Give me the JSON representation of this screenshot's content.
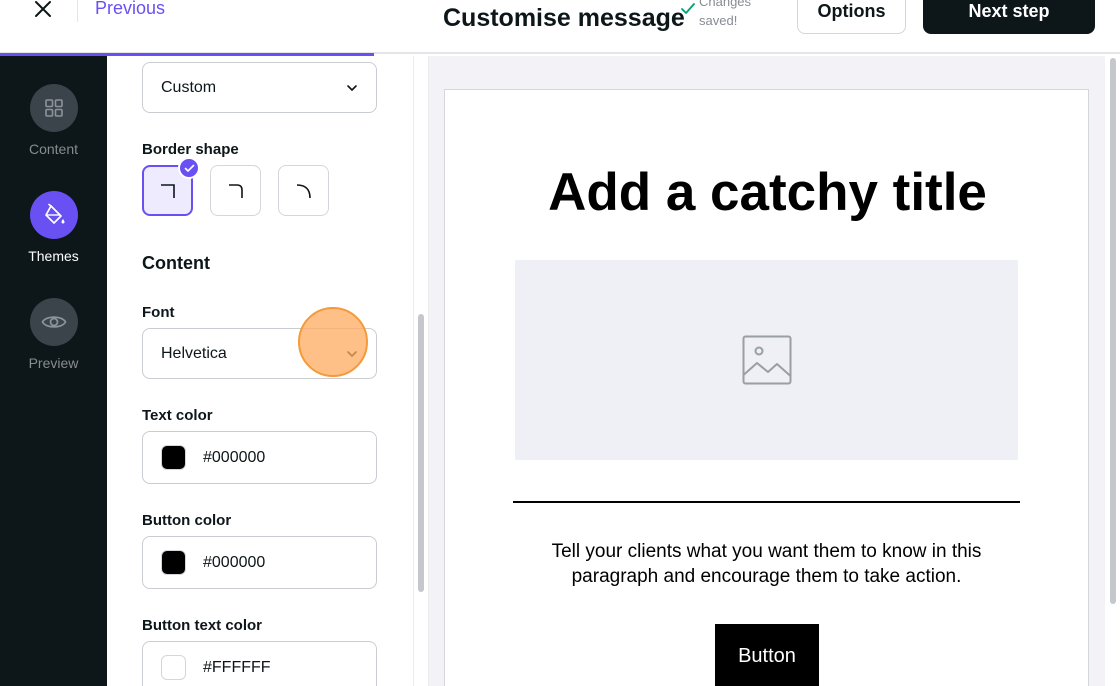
{
  "header": {
    "previous_label": "Previous",
    "title": "Customise message",
    "saved_status": "Changes saved!",
    "options_label": "Options",
    "next_label": "Next step"
  },
  "nav": {
    "items": [
      {
        "label": "Content",
        "icon": "grid-icon"
      },
      {
        "label": "Themes",
        "icon": "paint-bucket-icon",
        "active": true
      },
      {
        "label": "Preview",
        "icon": "eye-icon"
      }
    ]
  },
  "panel": {
    "style_select_value": "Custom",
    "border_shape_label": "Border shape",
    "border_shapes": [
      "square",
      "rounded",
      "round"
    ],
    "selected_border_shape": "square",
    "content_heading": "Content",
    "font_label": "Font",
    "font_value": "Helvetica",
    "text_color_label": "Text color",
    "text_color_value": "#000000",
    "button_color_label": "Button color",
    "button_color_value": "#000000",
    "button_text_color_label": "Button text color",
    "button_text_color_value": "#FFFFFF"
  },
  "preview": {
    "title": "Add a catchy title",
    "paragraph": "Tell your clients what you want them to know in this paragraph and encourage them to take action.",
    "button_label": "Button",
    "image_icon": "image-placeholder-icon"
  },
  "colors": {
    "accent": "#6950f3",
    "dark": "#0d1619"
  }
}
